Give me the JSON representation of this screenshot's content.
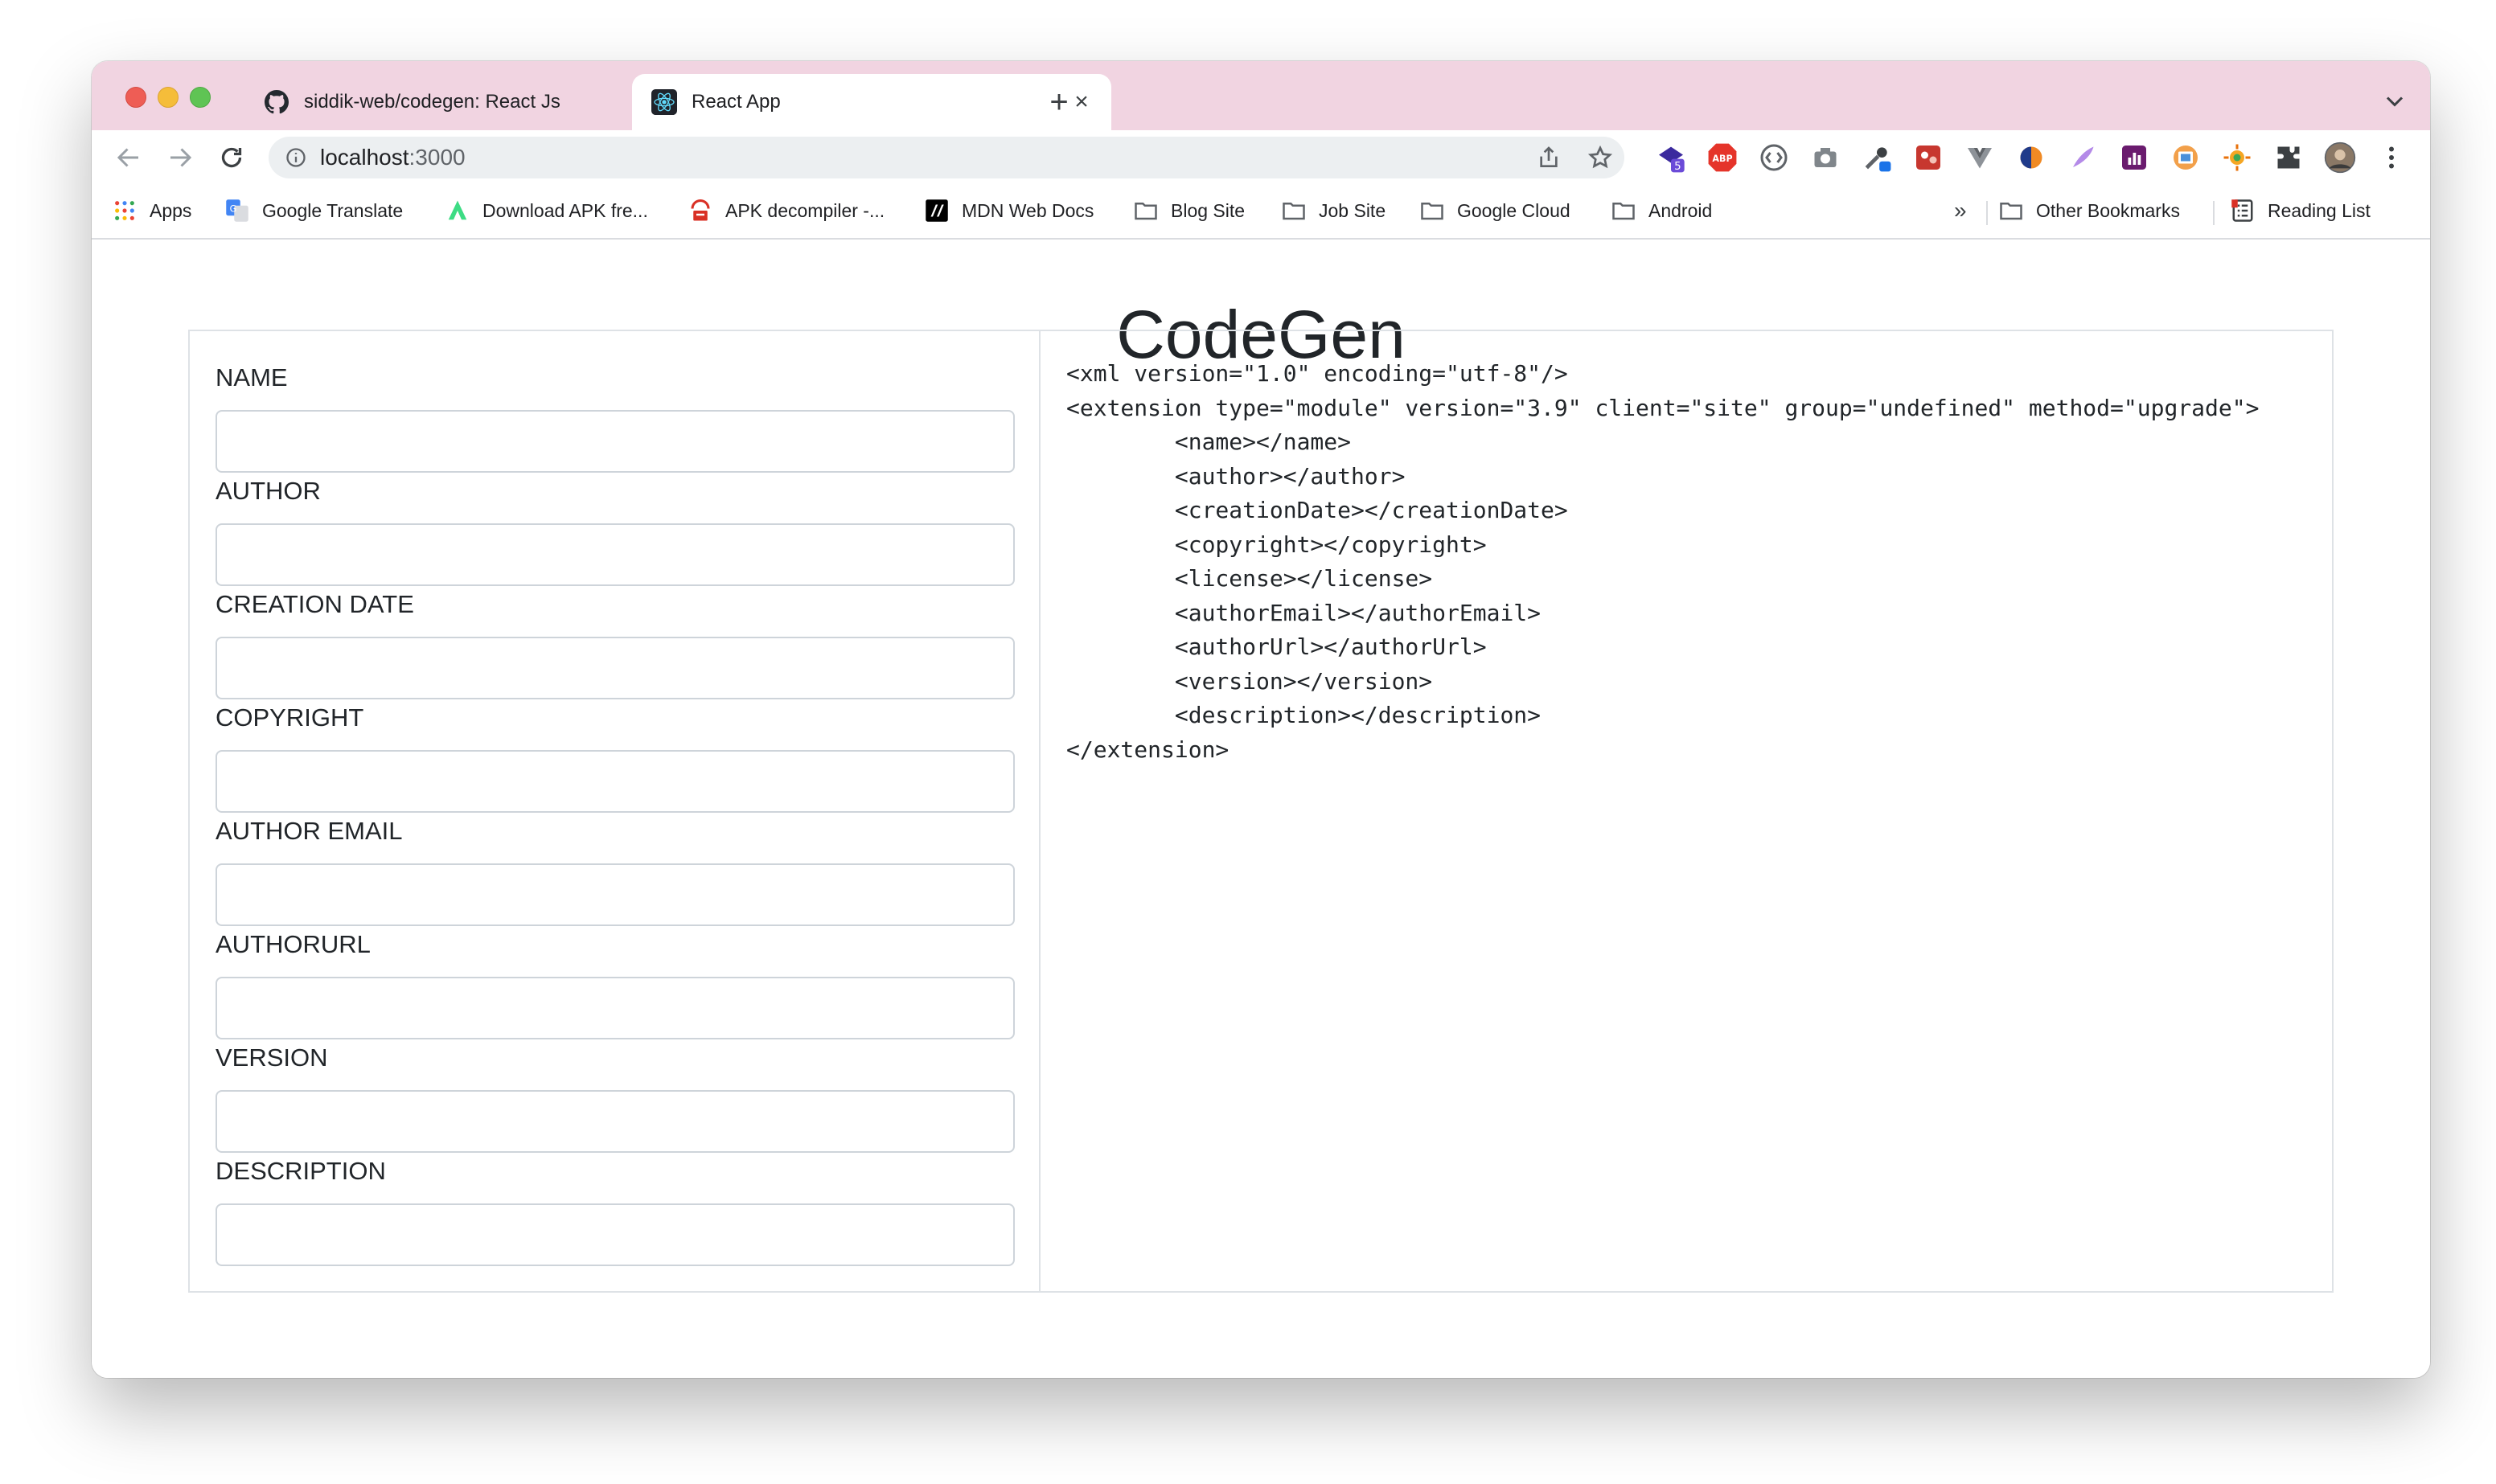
{
  "browser": {
    "tabs": [
      {
        "title": "siddik-web/codegen: React Js",
        "active": false,
        "icon": "github-icon"
      },
      {
        "title": "React App",
        "active": true,
        "icon": "react-icon"
      }
    ],
    "new_tab_label": "+",
    "url_host": "localhost",
    "url_port": ":3000",
    "extensions": [
      {
        "name": "extension-badge-icon",
        "badge": "5"
      },
      {
        "name": "adblock-icon",
        "label": "ABP"
      },
      {
        "name": "bracket-extension-icon"
      },
      {
        "name": "camera-icon"
      },
      {
        "name": "eyedropper-icon"
      },
      {
        "name": "gallery-extension-icon"
      },
      {
        "name": "vue-devtools-icon"
      },
      {
        "name": "orange-swirl-icon"
      },
      {
        "name": "feather-icon"
      },
      {
        "name": "chart-extension-icon"
      },
      {
        "name": "photo-extension-icon"
      },
      {
        "name": "sun-extension-icon"
      },
      {
        "name": "puzzle-icon"
      },
      {
        "name": "profile-avatar-icon"
      },
      {
        "name": "more-menu-icon"
      }
    ]
  },
  "bookmarks": {
    "items": [
      {
        "label": "Apps",
        "icon": "apps-grid-icon"
      },
      {
        "label": "Google Translate",
        "icon": "google-translate-icon"
      },
      {
        "label": "Download APK fre...",
        "icon": "apk-icon"
      },
      {
        "label": "APK decompiler -...",
        "icon": "decompiler-icon"
      },
      {
        "label": "MDN Web Docs",
        "icon": "mdn-icon"
      },
      {
        "label": "Blog Site",
        "icon": "folder-icon"
      },
      {
        "label": "Job Site",
        "icon": "folder-icon"
      },
      {
        "label": "Google Cloud",
        "icon": "folder-icon"
      },
      {
        "label": "Android",
        "icon": "folder-icon"
      }
    ],
    "overflow": "»",
    "other": "Other Bookmarks",
    "reading_list": "Reading List"
  },
  "page": {
    "title": "CodeGen",
    "fields": [
      {
        "label": "NAME",
        "value": ""
      },
      {
        "label": "AUTHOR",
        "value": ""
      },
      {
        "label": "CREATION DATE",
        "value": ""
      },
      {
        "label": "COPYRIGHT",
        "value": ""
      },
      {
        "label": "AUTHOR EMAIL",
        "value": ""
      },
      {
        "label": "AUTHORURL",
        "value": ""
      },
      {
        "label": "VERSION",
        "value": ""
      },
      {
        "label": "DESCRIPTION",
        "value": ""
      }
    ],
    "code_output": "<xml version=\"1.0\" encoding=\"utf-8\"/>\n<extension type=\"module\" version=\"3.9\" client=\"site\" group=\"undefined\" method=\"upgrade\">\n        <name></name>\n        <author></author>\n        <creationDate></creationDate>\n        <copyright></copyright>\n        <license></license>\n        <authorEmail></authorEmail>\n        <authorUrl></authorUrl>\n        <version></version>\n        <description></description>\n</extension>"
  },
  "colors": {
    "tabstrip": "#f1d4e1",
    "text": "#212529",
    "border": "#dee2e6"
  }
}
